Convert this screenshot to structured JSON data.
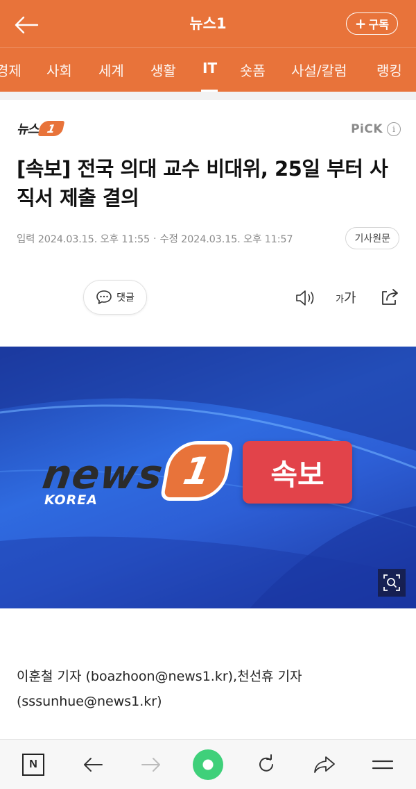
{
  "header": {
    "title": "뉴스1",
    "subscribe_label": "구독",
    "subscribe_plus": "+"
  },
  "tabs": [
    {
      "label": "경제"
    },
    {
      "label": "사회"
    },
    {
      "label": "세계"
    },
    {
      "label": "생활"
    },
    {
      "label": "IT",
      "active": true
    },
    {
      "label": "숏폼"
    },
    {
      "label": "사설/칼럼"
    },
    {
      "label": "랭킹"
    }
  ],
  "article": {
    "brand": "뉴스",
    "brand_one": "1",
    "pick_label": "PiCK",
    "pick_info": "i",
    "headline": "[속보] 전국 의대 교수 비대위, 25일 부터 사직서 제출 결의",
    "published": "입력 2024.03.15. 오후 11:55",
    "modified": "수정 2024.03.15. 오후 11:57",
    "meta_sep": "·",
    "original_link": "기사원문",
    "comment_label": "댓글",
    "font_small": "가",
    "font_big": "가",
    "byline": "이훈철 기자 (boazhoon@news1.kr),천선휴 기자 (sssunhue@news1.kr)"
  },
  "hero": {
    "news_word": "news",
    "news_one": "1",
    "korea": "KOREA",
    "breaking": "속보"
  },
  "bottom_bar": {
    "n_label": "N"
  },
  "colors": {
    "header": "#e8733a",
    "breaking_badge": "#e2434a",
    "home_dot": "#3fd07a"
  },
  "icons": {
    "back": "back-arrow-icon",
    "info": "info-icon",
    "comment": "speech-bubble-icon",
    "audio": "speaker-icon",
    "share": "share-icon",
    "zoom": "zoom-icon",
    "reload": "reload-icon",
    "forward": "forward-arrow-icon",
    "menu": "menu-icon"
  }
}
